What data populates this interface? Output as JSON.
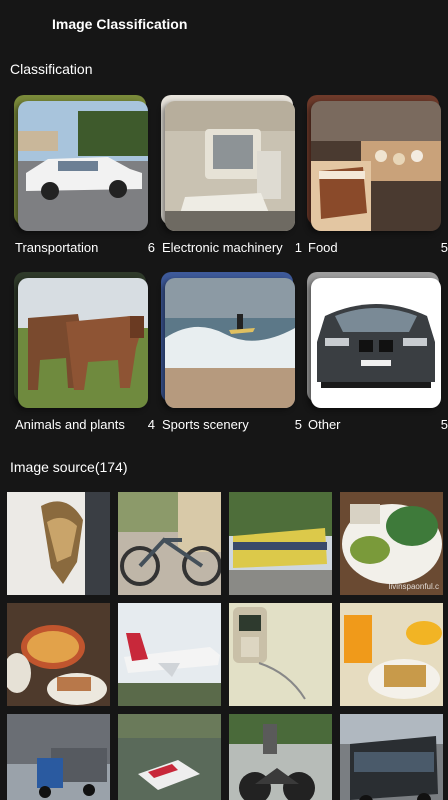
{
  "app": {
    "title": "Image Classification"
  },
  "classification": {
    "heading": "Classification",
    "categories": [
      {
        "label": "Transportation",
        "count": "6",
        "icon": "car-photo"
      },
      {
        "label": "Electronic machinery",
        "count": "1",
        "icon": "computer-photo"
      },
      {
        "label": "Food",
        "count": "5",
        "icon": "cake-photo"
      },
      {
        "label": "Animals and plants",
        "count": "4",
        "icon": "horses-photo"
      },
      {
        "label": "Sports scenery",
        "count": "5",
        "icon": "surfer-photo"
      },
      {
        "label": "Other",
        "count": "5",
        "icon": "bmw-photo"
      }
    ]
  },
  "source": {
    "heading": "Image source(174)",
    "images": [
      {
        "name": "bird-photo"
      },
      {
        "name": "bicycle-photo"
      },
      {
        "name": "train-photo",
        "caption": ""
      },
      {
        "name": "salad-plate-photo",
        "watermark": "livinspaonful.c"
      },
      {
        "name": "pizza-table-photo"
      },
      {
        "name": "airplane-photo"
      },
      {
        "name": "phone-photo"
      },
      {
        "name": "juice-breakfast-photo"
      },
      {
        "name": "truck-photo"
      },
      {
        "name": "flooded-car-photo"
      },
      {
        "name": "motorcycle-photo"
      },
      {
        "name": "bus-photo"
      }
    ]
  },
  "colors": {
    "background": "#161616",
    "text": "#ffffff"
  }
}
